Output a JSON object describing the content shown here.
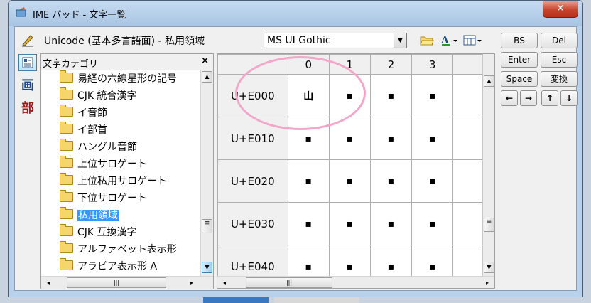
{
  "window": {
    "title": "IME パッド - 文字一覧",
    "close_label": "✕"
  },
  "left_toolbar": {
    "kanji1": "画",
    "kanji2": "部"
  },
  "header": {
    "title": "Unicode (基本多言語面) - 私用領域",
    "font_value": "MS UI Gothic"
  },
  "category_panel": {
    "header_label": "文字カテゴリ",
    "close_label": "×",
    "items": [
      {
        "label": "易経の六線星形の記号",
        "selected": false
      },
      {
        "label": "CJK 統合漢字",
        "selected": false
      },
      {
        "label": "イ音節",
        "selected": false
      },
      {
        "label": "イ部首",
        "selected": false
      },
      {
        "label": "ハングル音節",
        "selected": false
      },
      {
        "label": "上位サロゲート",
        "selected": false
      },
      {
        "label": "上位私用サロゲート",
        "selected": false
      },
      {
        "label": "下位サロゲート",
        "selected": false
      },
      {
        "label": "私用領域",
        "selected": true
      },
      {
        "label": "CJK 互換漢字",
        "selected": false
      },
      {
        "label": "アルファベット表示形",
        "selected": false
      },
      {
        "label": "アラビア表示形 A",
        "selected": false
      }
    ]
  },
  "grid": {
    "columns": [
      "0",
      "1",
      "2",
      "3"
    ],
    "rows": [
      {
        "code": "U+E000",
        "cells": [
          "山",
          "▪",
          "▪",
          "▪"
        ]
      },
      {
        "code": "U+E010",
        "cells": [
          "▪",
          "▪",
          "▪",
          "▪"
        ]
      },
      {
        "code": "U+E020",
        "cells": [
          "▪",
          "▪",
          "▪",
          "▪"
        ]
      },
      {
        "code": "U+E030",
        "cells": [
          "▪",
          "▪",
          "▪",
          "▪"
        ]
      },
      {
        "code": "U+E040",
        "cells": [
          "▪",
          "▪",
          "▪",
          "▪"
        ]
      }
    ]
  },
  "keys": {
    "bs": "BS",
    "del": "Del",
    "enter": "Enter",
    "esc": "Esc",
    "space": "Space",
    "convert": "変換",
    "left": "←",
    "right": "→",
    "up": "↑",
    "down": "↓"
  },
  "colors": {
    "selection": "#3399ff",
    "highlight_ring": "#f3a6c9",
    "close_button": "#c9452c"
  }
}
